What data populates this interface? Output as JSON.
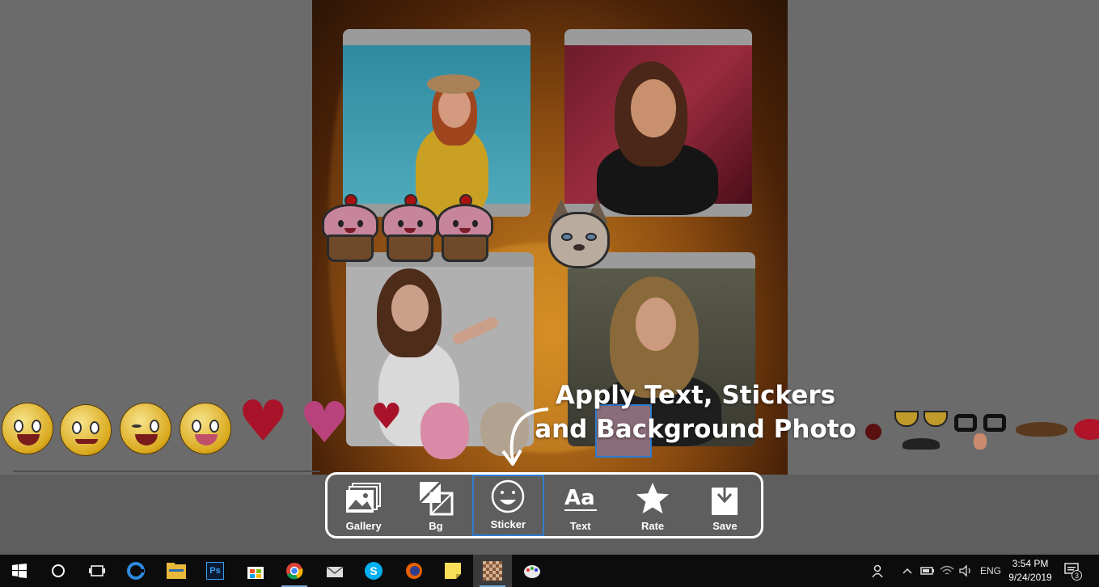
{
  "annotation": {
    "line1": "Apply Text, Stickers",
    "line2": "and Background Photo"
  },
  "toolbar": {
    "items": [
      {
        "label": "Gallery",
        "icon": "gallery-icon",
        "selected": false
      },
      {
        "label": "Bg",
        "icon": "background-icon",
        "selected": false
      },
      {
        "label": "Sticker",
        "icon": "sticker-icon",
        "selected": true
      },
      {
        "label": "Text",
        "icon": "text-icon",
        "selected": false
      },
      {
        "label": "Rate",
        "icon": "star-icon",
        "selected": false
      },
      {
        "label": "Save",
        "icon": "save-icon",
        "selected": false
      }
    ],
    "selected_color": "#2f7ccf"
  },
  "sticker_strip": {
    "items": [
      "laughing-emoji",
      "heart-eyes-emoji",
      "thumbs-up-emoji",
      "tongue-emoji",
      "red-heart",
      "sparkle-heart",
      "hearts-cluster",
      "owl",
      "grumpy-cat",
      "cat-ears",
      "cupcake",
      "sunglasses",
      "nerd-glasses",
      "mustache",
      "lips"
    ]
  },
  "taskbar": {
    "apps": [
      "start-icon",
      "cortana-icon",
      "task-view-icon",
      "edge-icon",
      "file-explorer-icon",
      "photoshop-icon",
      "store-icon",
      "chrome-icon",
      "mail-icon",
      "skype-icon",
      "firefox-icon",
      "sticky-notes-icon",
      "collage-app-icon",
      "paint-icon"
    ],
    "language": "ENG",
    "time": "3:54 PM",
    "date": "9/24/2019",
    "notifications": "3"
  },
  "colors": {
    "overlay": "#6b6b6b",
    "toolbar_bg": "#5e5e5e",
    "taskbar_bg": "#0c0c0c"
  }
}
